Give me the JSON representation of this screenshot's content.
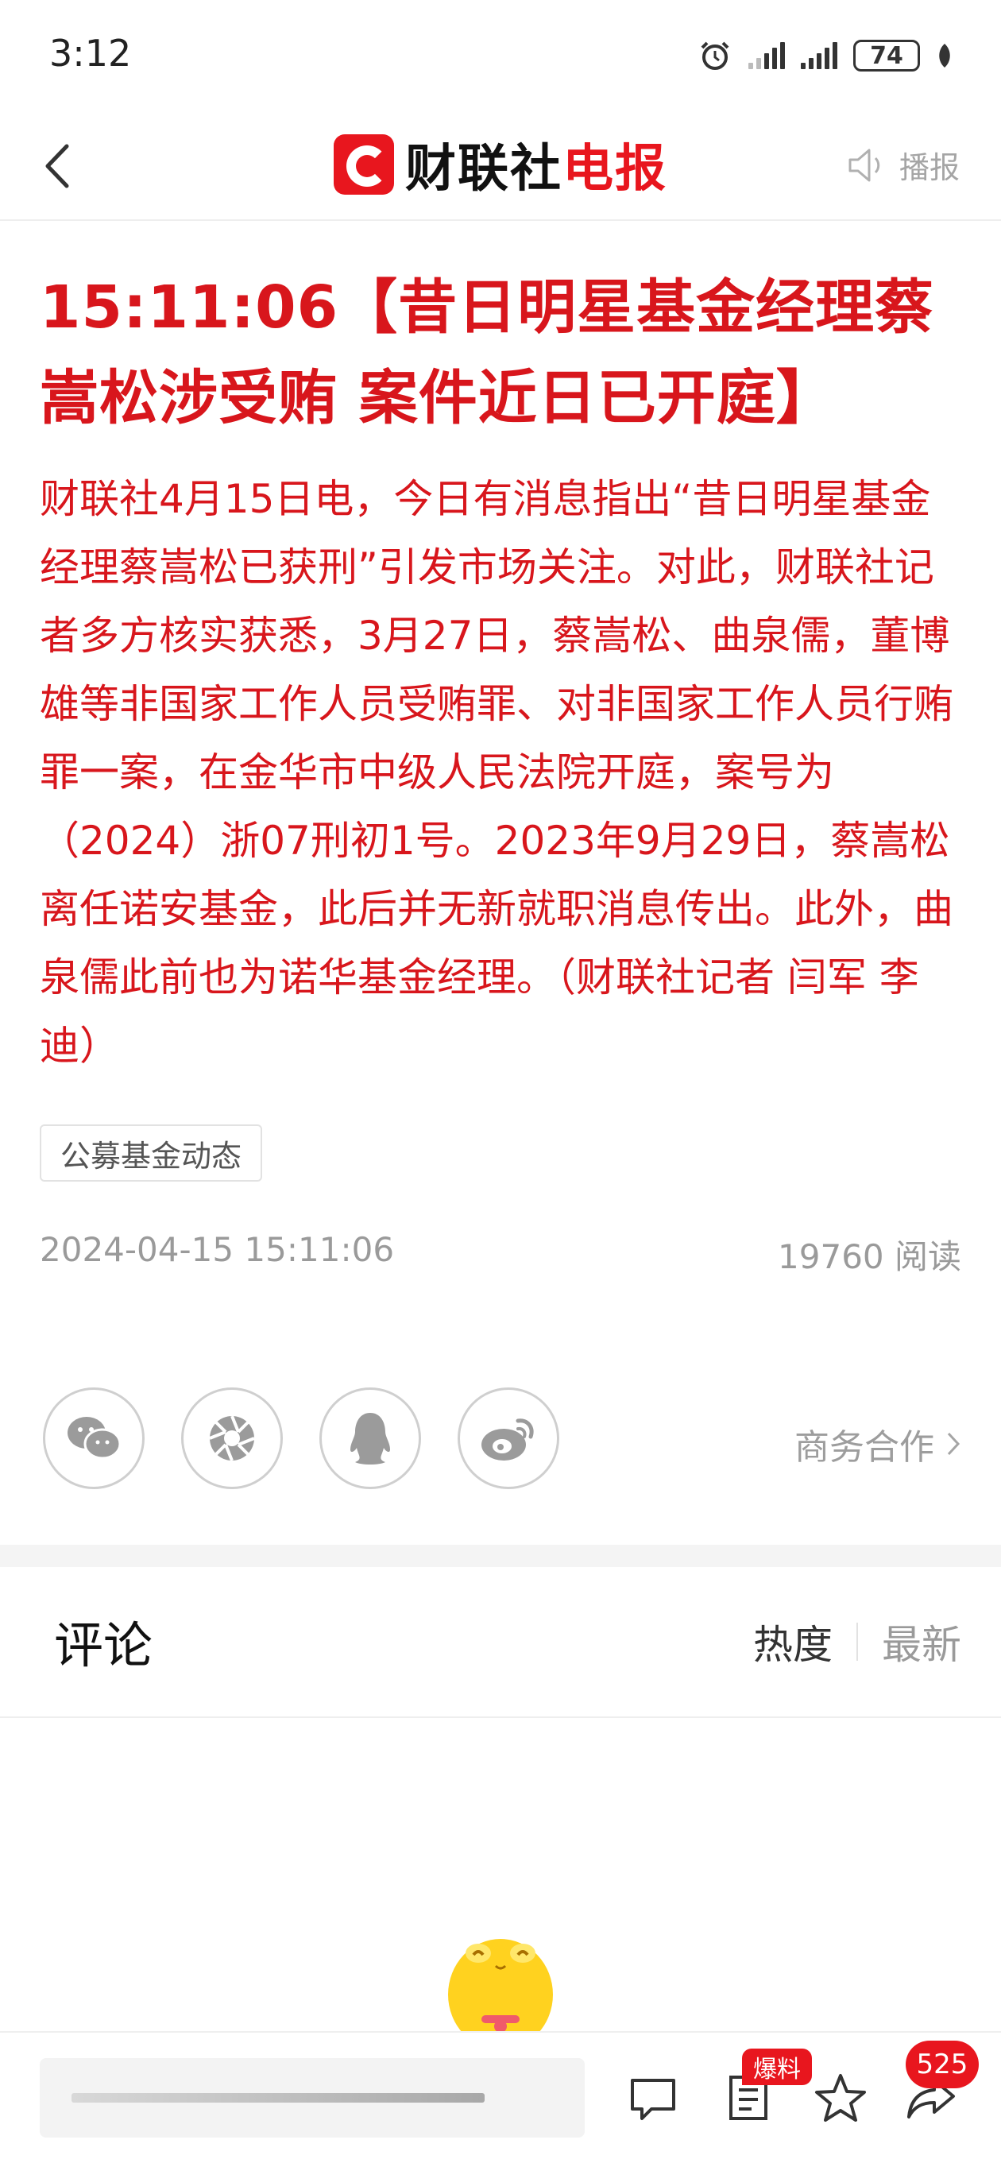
{
  "status_bar": {
    "time": "3:12",
    "battery": "74"
  },
  "header": {
    "logo_black": "财联社",
    "logo_red": "电报",
    "broadcast_label": "播报"
  },
  "article": {
    "headline": "15:11:06【昔日明星基金经理蔡嵩松涉受贿 案件近日已开庭】",
    "body": "财联社4月15日电，今日有消息指出“昔日明星基金经理蔡嵩松已获刑”引发市场关注。对此，财联社记者多方核实获悉，3月27日，蔡嵩松、曲泉儒，董博雄等非国家工作人员受贿罪、对非国家工作人员行贿罪一案，在金华市中级人民法院开庭，案号为（2024）浙07刑初1号。2023年9月29日，蔡嵩松离任诺安基金，此后并无新就职消息传出。此外，曲泉儒此前也为诺华基金经理。（财联社记者 闫军 李迪）",
    "tag": "公募基金动态",
    "date": "2024-04-15 15:11:06",
    "reads": "19760 阅读"
  },
  "share": {
    "icons": [
      "wechat-icon",
      "moments-icon",
      "qq-icon",
      "weibo-icon"
    ],
    "business_label": "商务合作"
  },
  "comments": {
    "title": "评论",
    "sort_hot": "热度",
    "sort_new": "最新"
  },
  "bottom_bar": {
    "baoliao_badge": "爆料",
    "share_count": "525"
  },
  "colors": {
    "accent": "#e8161e",
    "headline": "#d8161c",
    "muted": "#9a9a9a"
  }
}
